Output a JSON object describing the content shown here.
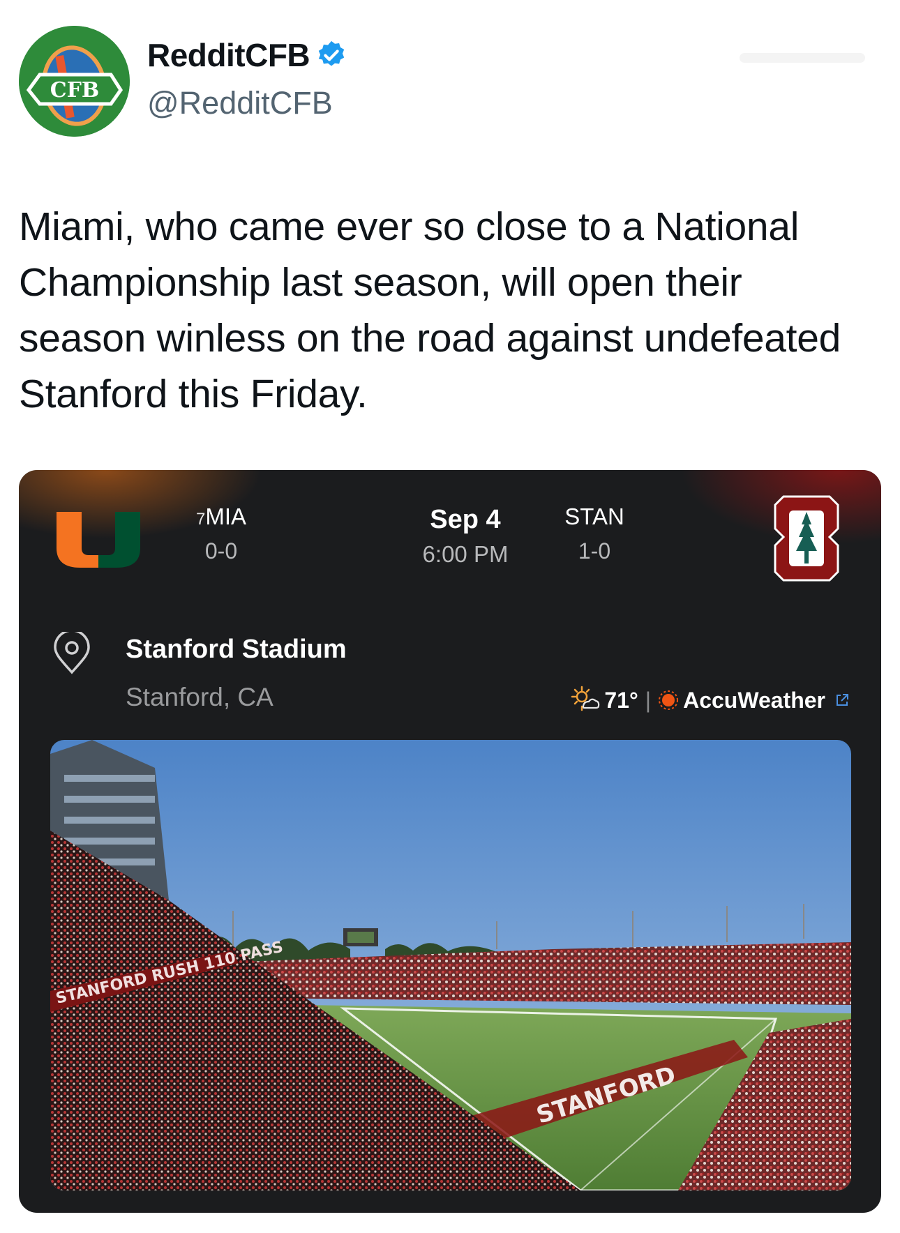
{
  "account": {
    "display_name": "RedditCFB",
    "handle": "@RedditCFB",
    "avatar_text": "CFB",
    "verified": true
  },
  "tweet": {
    "text": "Miami, who came ever so close to a National Championship last season, will open their season winless on the road against undefeated Stanford this Friday."
  },
  "game_card": {
    "away": {
      "rank": "7",
      "abbr": "MIA",
      "record": "0-0",
      "logo": "miami-u-logo",
      "color": "#f47321"
    },
    "home": {
      "abbr": "STAN",
      "record": "1-0",
      "logo": "stanford-s-logo",
      "color": "#8c1515"
    },
    "date": "Sep 4",
    "time": "6:00 PM",
    "venue": {
      "name": "Stanford Stadium",
      "location": "Stanford, CA",
      "icon": "location-pin-icon"
    },
    "weather": {
      "temp": "71°",
      "icon": "partly-sunny-icon",
      "provider": "AccuWeather",
      "provider_icon": "external-link-icon"
    },
    "photo": {
      "subject": "stanford-stadium-photo",
      "end_zone_text": "STANFORD",
      "sideline_text": "STANFORD  RUSH 110  PASS"
    }
  }
}
